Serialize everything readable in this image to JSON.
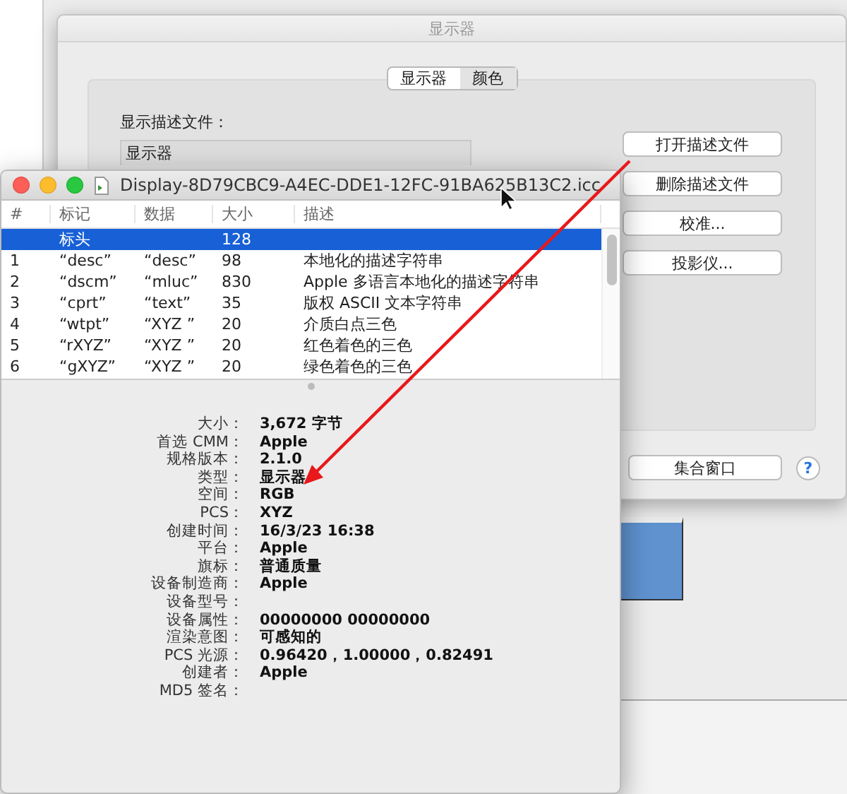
{
  "display_window": {
    "title": "显示器",
    "segments": [
      {
        "label": "显示器",
        "selected": true
      },
      {
        "label": "颜色",
        "selected": false
      }
    ],
    "profile_label": "显示描述文件：",
    "profile_list_header": "显示器",
    "buttons": [
      "打开描述文件",
      "删除描述文件",
      "校准...",
      "投影仪..."
    ],
    "gather_button": "集合窗口",
    "help_button": "?"
  },
  "profile_window": {
    "title": "Display-8D79CBC9-A4EC-DDE1-12FC-91BA625B13C2.icc",
    "columns": [
      "#",
      "标记",
      "数据",
      "大小",
      "描述"
    ],
    "rows": [
      {
        "tag": "标头",
        "size": "128",
        "selected": true
      },
      {
        "number": "1",
        "tag": "“desc”",
        "data": "“desc”",
        "size": "98",
        "description": "本地化的描述字符串",
        "selected": false
      },
      {
        "number": "2",
        "tag": "“dscm”",
        "data": "“mluc”",
        "size": "830",
        "description": "Apple 多语言本地化的描述字符串",
        "selected": false
      },
      {
        "number": "3",
        "tag": "“cprt”",
        "data": "“text”",
        "size": "35",
        "description": "版权 ASCII 文本字符串",
        "selected": false
      },
      {
        "number": "4",
        "tag": "“wtpt”",
        "data": "“XYZ ”",
        "size": "20",
        "description": "介质白点三色",
        "selected": false
      },
      {
        "number": "5",
        "tag": "“rXYZ”",
        "data": "“XYZ ”",
        "size": "20",
        "description": "红色着色的三色",
        "selected": false
      },
      {
        "number": "6",
        "tag": "“gXYZ”",
        "data": "“XYZ ”",
        "size": "20",
        "description": "绿色着色的三色",
        "selected": false
      }
    ],
    "info": [
      {
        "label": "大小：",
        "value": "3,672 字节"
      },
      {
        "label": "首选 CMM：",
        "value": "Apple"
      },
      {
        "label": "规格版本：",
        "value": "2.1.0"
      },
      {
        "label": "类型：",
        "value": "显示器"
      },
      {
        "label": "空间：",
        "value": "RGB"
      },
      {
        "label": "PCS：",
        "value": "XYZ"
      },
      {
        "label": "创建时间：",
        "value": "16/3/23 16:38"
      },
      {
        "label": "平台：",
        "value": "Apple"
      },
      {
        "label": "旗标：",
        "value": "普通质量"
      },
      {
        "label": "设备制造商：",
        "value": "Apple"
      },
      {
        "label": "设备型号："
      },
      {
        "label": "设备属性：",
        "value": "00000000 00000000"
      },
      {
        "label": "渲染意图：",
        "value": "可感知的"
      },
      {
        "label": "PCS 光源：",
        "value": "0.96420，1.00000，0.82491"
      },
      {
        "label": "创建者：",
        "value": "Apple"
      },
      {
        "label": "MD5 签名："
      }
    ]
  }
}
